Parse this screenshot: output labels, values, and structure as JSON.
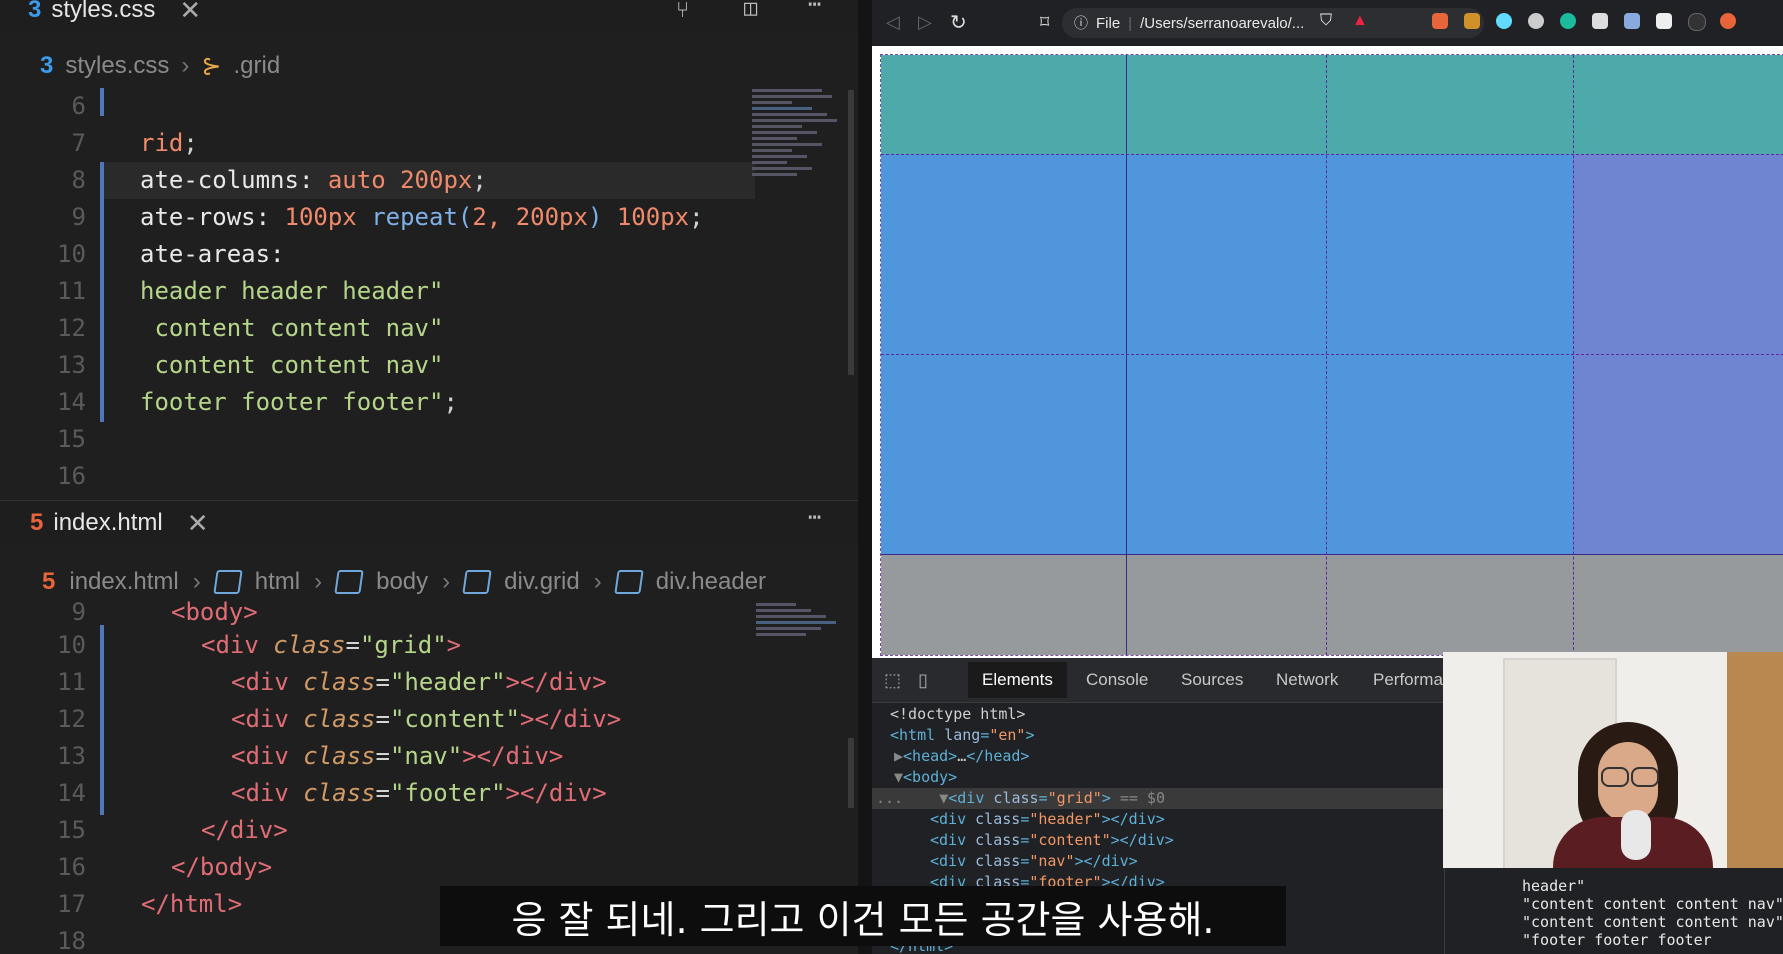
{
  "css_editor": {
    "tab_title": "styles.css",
    "breadcrumb_file": "styles.css",
    "breadcrumb_symbol": ".grid",
    "lines": [
      {
        "n": "6",
        "text": ""
      },
      {
        "n": "7",
        "text": "rid;"
      },
      {
        "n": "8",
        "text": "ate-columns: auto 200px;"
      },
      {
        "n": "9",
        "text": "ate-rows: 100px repeat(2, 200px) 100px;"
      },
      {
        "n": "10",
        "text": "ate-areas:"
      },
      {
        "n": "11",
        "text": "header header header\""
      },
      {
        "n": "12",
        "text": " content content nav\""
      },
      {
        "n": "13",
        "text": " content content nav\""
      },
      {
        "n": "14",
        "text": "footer footer footer\";"
      },
      {
        "n": "15",
        "text": ""
      },
      {
        "n": "16",
        "text": ""
      }
    ]
  },
  "html_editor": {
    "tab_title": "index.html",
    "breadcrumbs": [
      "index.html",
      "html",
      "body",
      "div.grid",
      "div.header"
    ],
    "lines": [
      {
        "n": "9",
        "text": "<body>"
      },
      {
        "n": "10",
        "text": "<div class=\"grid\">"
      },
      {
        "n": "11",
        "text": "<div class=\"header\"></div>"
      },
      {
        "n": "12",
        "text": "<div class=\"content\"></div>"
      },
      {
        "n": "13",
        "text": "<div class=\"nav\"></div>"
      },
      {
        "n": "14",
        "text": "<div class=\"footer\"></div>"
      },
      {
        "n": "15",
        "text": "</div>"
      },
      {
        "n": "16",
        "text": "</body>"
      },
      {
        "n": "17",
        "text": "</html>"
      },
      {
        "n": "18",
        "text": ""
      }
    ]
  },
  "browser": {
    "url_prefix": "File",
    "url": "/Users/serranoarevalo/...",
    "colors": {
      "header": "#4eaaaa",
      "content": "#5096dc",
      "nav": "#6f85d2",
      "footer": "#969a9c"
    }
  },
  "devtools": {
    "tabs": [
      "Elements",
      "Console",
      "Sources",
      "Network",
      "Performa"
    ],
    "active_tab": "Elements",
    "dom_lines": [
      "<!doctype html>",
      "<html lang=\"en\">",
      "▶<head>…</head>",
      "▼<body>",
      "▼<div class=\"grid\"> == $0",
      "<div class=\"header\"></div>",
      "<div class=\"content\"></div>",
      "<div class=\"nav\"></div>",
      "<div class=\"footer\"></div>",
      "</html>"
    ],
    "ellipsis": "..."
  },
  "styles_panel": {
    "lines": [
      "header\"",
      "\"content content content nav\"",
      "\"content content content nav\"",
      "\"footer footer footer"
    ]
  },
  "subtitle": "응 잘 되네. 그리고 이건 모든 공간을 사용해."
}
